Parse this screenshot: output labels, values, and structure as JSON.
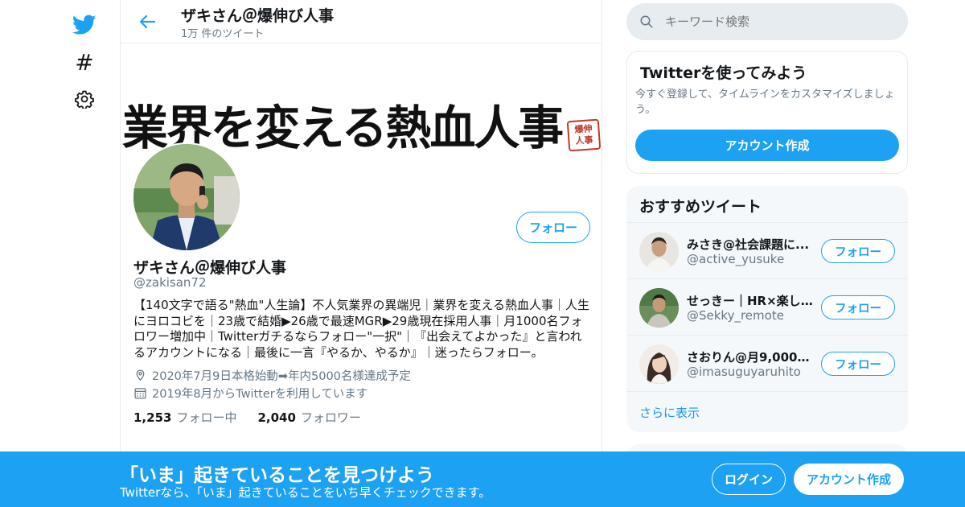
{
  "colors": {
    "accent": "#1da1f2",
    "muted": "#657786",
    "border": "#e6ecf0",
    "panel": "#f5f8fa"
  },
  "nav": {
    "logo_icon": "twitter-bird-icon",
    "explore_icon": "hashtag-icon",
    "settings_icon": "gear-icon"
  },
  "header": {
    "back_icon": "arrow-left-icon",
    "name": "ザキさん＠爆伸び人事",
    "tweet_count": "1万 件のツイート"
  },
  "banner": {
    "headline": "業界を変える熱血人事",
    "seal_text": "爆伸人事"
  },
  "profile": {
    "name": "ザキさん＠爆伸び人事",
    "handle": "@zakisan72",
    "bio": "【140文字で語る\"熱血\"人生論】不人気業界の異端児｜業界を変える熱血人事｜人生にヨロコビを｜23歳で結婚▶26歳で最速MGR▶29歳現在採用人事｜月1000名フォロワー増加中｜Twitterガチるならフォロー\"一択\"｜『出会えてよかった』と言われるアカウントになる｜最後に一言『やるか、やるか』｜迷ったらフォロー。",
    "location": "2020年7月9日本格始動➡年内5000名様達成予定",
    "joined": "2019年8月からTwitterを利用しています",
    "following_count": "1,253",
    "following_label": "フォロー中",
    "followers_count": "2,040",
    "followers_label": "フォロワー",
    "follow_label": "フォロー"
  },
  "search": {
    "placeholder": "キーワード検索"
  },
  "try_card": {
    "title": "Twitterを使ってみよう",
    "description": "今すぐ登録して、タイムラインをカスタマイズしましょう。",
    "button": "アカウント作成"
  },
  "recommended": {
    "title": "おすすめツイート",
    "items": [
      {
        "name": "みさき@社会課題に...",
        "handle": "@active_yusuke",
        "follow": "フォロー"
      },
      {
        "name": "せっきー｜HR×楽し...",
        "handle": "@Sekky_remote",
        "follow": "フォロー"
      },
      {
        "name": "さおりん@月9,000リ...",
        "handle": "@imasuguyaruhito",
        "follow": "フォロー"
      }
    ],
    "more": "さらに表示"
  },
  "bottom_bar": {
    "title": "「いま」起きていることを見つけよう",
    "subtitle": "Twitterなら、「いま」起きていることをいち早くチェックできます。",
    "login": "ログイン",
    "signup": "アカウント作成"
  }
}
